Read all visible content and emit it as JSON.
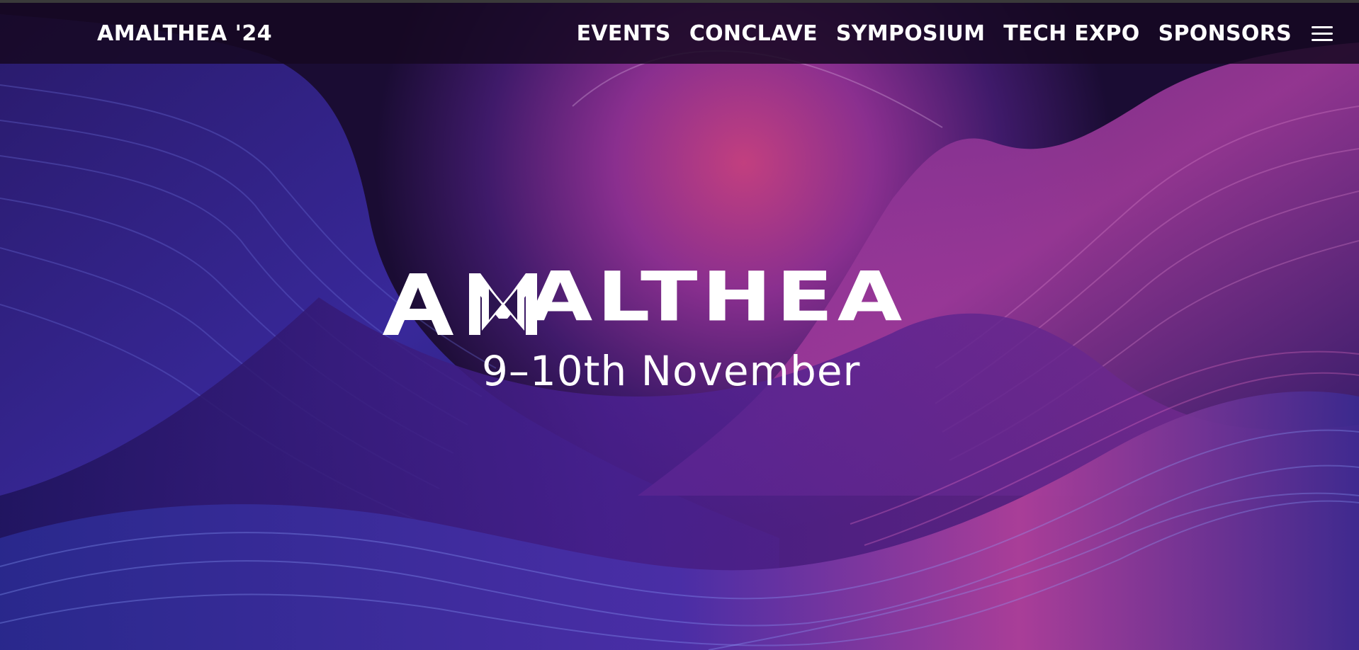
{
  "header": {
    "brand": "AMALTHEA '24",
    "nav": [
      {
        "label": "EVENTS"
      },
      {
        "label": "CONCLAVE"
      },
      {
        "label": "SYMPOSIUM"
      },
      {
        "label": "TECH EXPO"
      },
      {
        "label": "SPONSORS"
      }
    ],
    "menu_icon": "hamburger-menu-icon"
  },
  "hero": {
    "logo_text": "AMALTHEA",
    "date": "9–10th November",
    "background": "abstract purple wave artwork"
  },
  "colors": {
    "topbar": "#160822",
    "text": "#ffffff",
    "accent_magenta": "#c23f9a",
    "accent_violet": "#5b2bb8",
    "deep_indigo": "#1a1050"
  }
}
